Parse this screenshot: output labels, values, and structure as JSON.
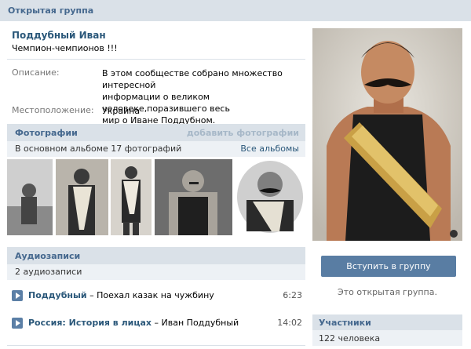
{
  "topbar": {
    "title": "Открытая группа"
  },
  "group": {
    "name": "Поддубный Иван",
    "status": "Чемпион-чемпионов !!!",
    "info": {
      "description_label": "Описание:",
      "description_lines": [
        "В этом сообществе собрано множество интересной",
        "информации о великом человеке,поразившего весь",
        "мир о Иване Поддубном."
      ],
      "location_label": "Местоположение:",
      "location_value": "Украина"
    }
  },
  "photos": {
    "title": "Фотографии",
    "add_link": "добавить фотографии",
    "album_text": "В основном альбоме 17 фотографий",
    "all_albums": "Все альбомы",
    "thumbnails": [
      "photo-1",
      "photo-2",
      "photo-3",
      "photo-4",
      "photo-5"
    ]
  },
  "audio": {
    "title": "Аудиозаписи",
    "count_text": "2 аудиозаписи",
    "tracks": [
      {
        "artist": "Поддубный",
        "sep": " – ",
        "title": "Поехал казак на чужбину",
        "time": "6:23"
      },
      {
        "artist": "Россия: История в лицах",
        "sep": " – ",
        "title": "Иван Поддубный",
        "time": "14:02"
      }
    ]
  },
  "sidebar": {
    "join_button": "Вступить в группу",
    "open_text": "Это открытая группа.",
    "members_title": "Участники",
    "members_count": "122 человека"
  }
}
